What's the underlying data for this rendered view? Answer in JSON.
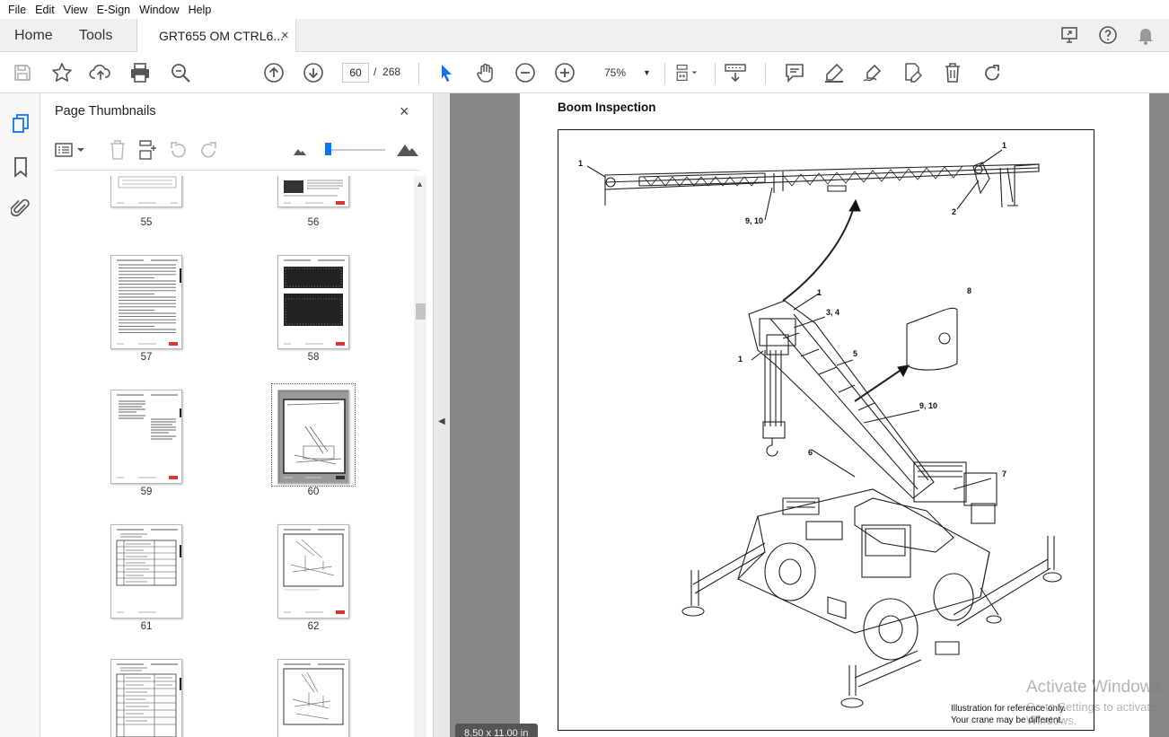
{
  "menu": [
    "File",
    "Edit",
    "View",
    "E-Sign",
    "Window",
    "Help"
  ],
  "tabs": {
    "home": "Home",
    "tools": "Tools",
    "document": "GRT655 OM CTRL6...",
    "close": "×"
  },
  "toolbar": {
    "current_page": "60",
    "page_separator": "/",
    "total_pages": "268",
    "zoom": "75%"
  },
  "panel": {
    "title": "Page Thumbnails",
    "close": "×",
    "thumbnails": [
      {
        "label": "55"
      },
      {
        "label": "56"
      },
      {
        "label": "57"
      },
      {
        "label": "58"
      },
      {
        "label": "59"
      },
      {
        "label": "60",
        "selected": true
      },
      {
        "label": "61"
      },
      {
        "label": "62"
      },
      {
        "label": ""
      },
      {
        "label": ""
      }
    ]
  },
  "document": {
    "heading": "Boom Inspection",
    "callouts": [
      "1",
      "1",
      "2",
      "9, 10",
      "1",
      "3, 4",
      "1",
      "5",
      "8",
      "9, 10",
      "6",
      "7"
    ],
    "caption_line1": "Illustration for reference only.",
    "caption_line2": "Your crane may be different."
  },
  "status": {
    "page_size": "8.50 x 11.00 in"
  },
  "watermark": {
    "line1": "Activate Windows",
    "line2": "Go to Settings to activate Windows."
  },
  "colors": {
    "accent": "#1473e6",
    "doc_background": "#878787",
    "tab_bar": "#f0f0f0"
  }
}
